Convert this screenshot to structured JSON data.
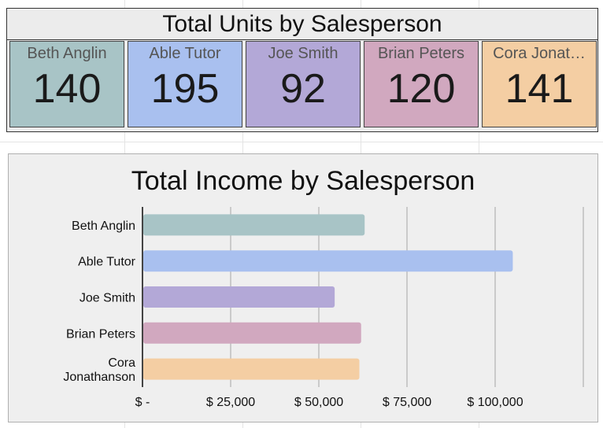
{
  "units_panel": {
    "title": "Total Units by Salesperson",
    "cards": [
      {
        "name": "Beth Anglin",
        "value": "140",
        "color": "#a8c4c6"
      },
      {
        "name": "Able Tutor",
        "value": "195",
        "color": "#a9c0ef"
      },
      {
        "name": "Joe Smith",
        "value": "92",
        "color": "#b3a8d7"
      },
      {
        "name": "Brian Peters",
        "value": "120",
        "color": "#d1a8bf"
      },
      {
        "name": "Cora Jonat…",
        "value": "141",
        "color": "#f4cea3"
      }
    ]
  },
  "chart_data": [
    {
      "type": "bar",
      "orientation": "horizontal",
      "title": "Total Units by Salesperson",
      "categories": [
        "Beth Anglin",
        "Able Tutor",
        "Joe Smith",
        "Brian Peters",
        "Cora Jonathanson"
      ],
      "values": [
        140,
        195,
        92,
        120,
        141
      ]
    },
    {
      "type": "bar",
      "orientation": "horizontal",
      "title": "Total Income by Salesperson",
      "categories": [
        "Beth Anglin",
        "Able Tutor",
        "Joe Smith",
        "Brian Peters",
        "Cora Jonathanson"
      ],
      "category_labels": [
        [
          "Beth Anglin"
        ],
        [
          "Able Tutor"
        ],
        [
          "Joe Smith"
        ],
        [
          "Brian Peters"
        ],
        [
          "Cora",
          "Jonathanson"
        ]
      ],
      "values": [
        63000,
        105000,
        54500,
        62000,
        61500
      ],
      "colors": [
        "#a8c4c6",
        "#a9c0ef",
        "#b3a8d7",
        "#d1a8bf",
        "#f4cea3"
      ],
      "xlim": [
        0,
        125000
      ],
      "xticks": [
        0,
        25000,
        50000,
        75000,
        100000,
        125000
      ],
      "xtick_labels": [
        "$ -",
        "$ 25,000",
        "$ 50,000",
        "$ 75,000",
        "$ 100,000",
        ""
      ],
      "grid": true
    }
  ]
}
